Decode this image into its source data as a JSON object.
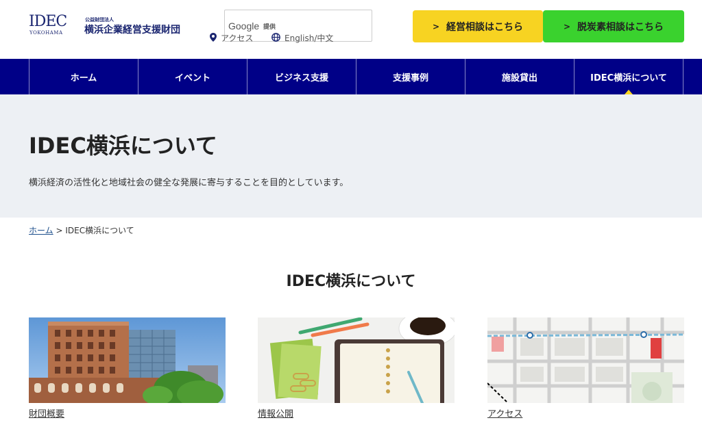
{
  "header": {
    "logo_main": "IDEC",
    "logo_sub": "YOKOHAMA",
    "org_small": "公益財団法人",
    "org_name": "横浜企業経営支援財団",
    "search": {
      "google_word": "Google",
      "provided_by": "提供"
    },
    "access_label": "アクセス",
    "language_label": "English/中文",
    "icons": {
      "access": "map-pin-icon",
      "language": "globe-icon",
      "chevron": "chevron-right-icon"
    },
    "cta_buttons": [
      {
        "label": "経営相談はこちら",
        "color": "#f7d322"
      },
      {
        "label": "脱炭素相談はこちら",
        "color": "#3ad22e"
      }
    ]
  },
  "nav": {
    "items": [
      {
        "label": "ホーム"
      },
      {
        "label": "イベント"
      },
      {
        "label": "ビジネス支援"
      },
      {
        "label": "支援事例"
      },
      {
        "label": "施設貸出"
      },
      {
        "label": "IDEC横浜について"
      }
    ],
    "active_index": 5,
    "color": "#000087"
  },
  "hero": {
    "title": "IDEC横浜について",
    "description": "横浜経済の活性化と地域社会の健全な発展に寄与することを目的としています。"
  },
  "breadcrumb": {
    "home": "ホーム",
    "separator": ">",
    "current": "IDEC横浜について"
  },
  "section": {
    "title": "IDEC横浜について",
    "cards": [
      {
        "label": "財団概要",
        "image": "building-photo"
      },
      {
        "label": "情報公開",
        "image": "notebook-photo"
      },
      {
        "label": "アクセス",
        "image": "map-image"
      }
    ]
  }
}
